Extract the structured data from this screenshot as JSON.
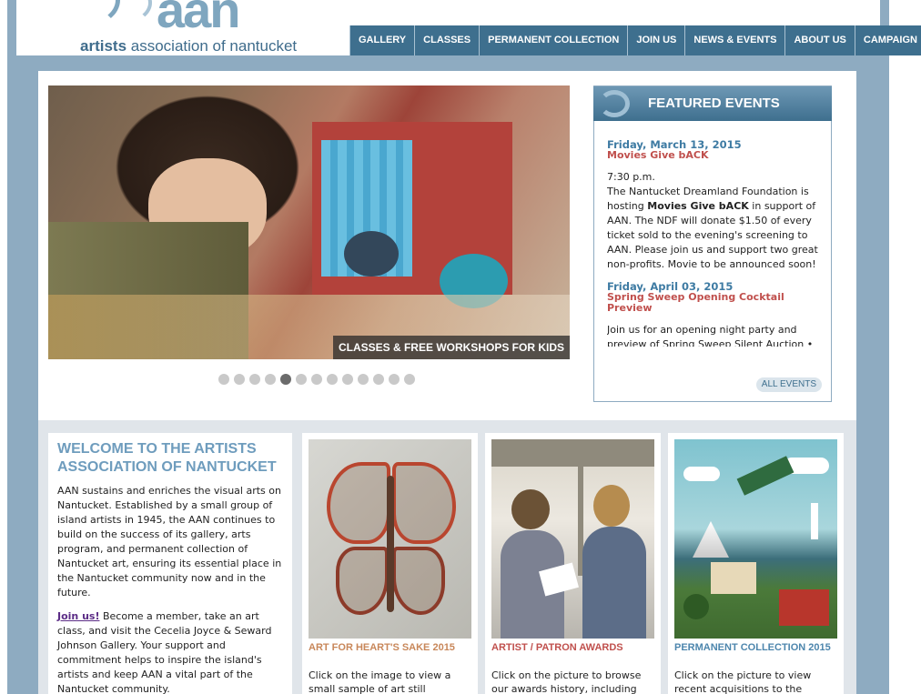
{
  "brand": {
    "logo_mark": "aan",
    "logo_text_bold": "artists",
    "logo_text": " association of nantucket"
  },
  "nav": [
    {
      "label": "GALLERY"
    },
    {
      "label": "CLASSES"
    },
    {
      "label": "PERMANENT COLLECTION"
    },
    {
      "label": "JOIN US"
    },
    {
      "label": "NEWS & EVENTS"
    },
    {
      "label": "ABOUT US"
    },
    {
      "label": "CAMPAIGN"
    }
  ],
  "slider": {
    "caption": "CLASSES & FREE WORKSHOPS FOR KIDS",
    "dot_count": 13,
    "active_index": 4
  },
  "events": {
    "heading": "FEATURED EVENTS",
    "items": [
      {
        "date": "Friday, March 13, 2015",
        "title": "Movies Give bACK",
        "time": "7:30 p.m.",
        "text_before": "The Nantucket Dreamland Foundation is hosting ",
        "text_bold": "Movies Give bACK",
        "text_after": " in support of AAN. The NDF will donate $1.50 of every ticket sold to the evening's screening to AAN. Please join us and support two great non-profits. Movie to be announced soon!"
      },
      {
        "date": "Friday, April 03, 2015",
        "title": "Spring Sweep Opening Cocktail Preview",
        "text": "Join us for an opening night party and preview of Spring Sweep Silent Auction •"
      }
    ],
    "all_events_label": "ALL EVENTS"
  },
  "welcome": {
    "heading": "WELCOME TO THE ARTISTS ASSOCIATION OF NANTUCKET",
    "paragraph": "AAN sustains and enriches the visual arts on Nantucket. Established by a small group of island artists in 1945, the AAN continues to build on the success of its gallery, arts program, and permanent collection of Nantucket art, ensuring its essential place in the Nantucket community now and in the future.",
    "join_link": "Join us!",
    "join_text": " Become a member, take an art class, and visit the Cecelia Joyce & Seward Johnson Gallery. Your support and commitment helps to inspire the island's artists and keep AAN a vital part of the Nantucket community."
  },
  "cards": [
    {
      "title": "ART FOR HEART'S SAKE 2015",
      "title_color": "#c8875a",
      "text": "Click on the image to view a small sample of art still"
    },
    {
      "title": "ARTIST / PATRON AWARDS",
      "title_color": "#c0504d",
      "text": "Click on the picture to browse our awards history, including"
    },
    {
      "title": "PERMANENT COLLECTION 2015",
      "title_color": "#4d86ad",
      "text": "Click on the picture to view recent acquisitions to the"
    }
  ]
}
